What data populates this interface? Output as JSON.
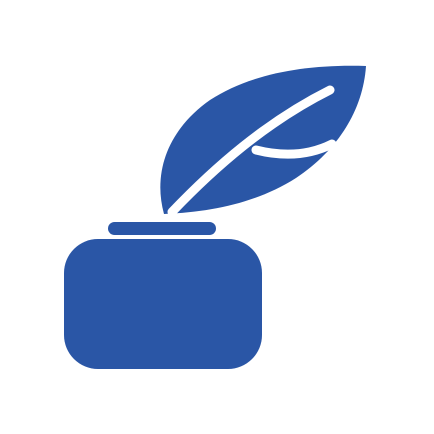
{
  "icon": {
    "name": "quill-and-inkwell-icon",
    "color": "#2A56A6",
    "background": "#FFFFFF",
    "highlight": "#FFFFFF"
  }
}
